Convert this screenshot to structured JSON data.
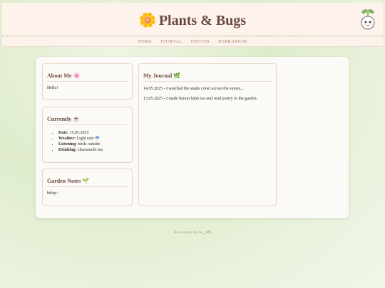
{
  "site": {
    "title": "Plants & Bugs",
    "title_icon": "sunflower-icon"
  },
  "nav": {
    "items": [
      "HOME",
      "JOURNAL",
      "PHOTOS",
      "HERBARIUM"
    ]
  },
  "about": {
    "heading": "About Me 🌸",
    "text": "Hello!"
  },
  "currently": {
    "heading": "Currently ☕",
    "items": [
      {
        "label": "Date:",
        "value": "15.05.2025"
      },
      {
        "label": "Weather:",
        "value": "Light rain ☔"
      },
      {
        "label": "Listening:",
        "value": "birds outside"
      },
      {
        "label": "Drinking:",
        "value": "chamomile tea"
      }
    ]
  },
  "garden": {
    "heading": "Garden Notes 🌱",
    "text": "hihip>"
  },
  "journal": {
    "heading": "My Journal 🌿",
    "entries": [
      "14.05.2025 - I watched the snails crawl across the stones...",
      "13.05.2025 - I made lemon balm tea and read poetry in the garden."
    ]
  },
  "footer": {
    "text": "Have a great day (◕‿◕✿)"
  },
  "colors": {
    "header_bg": "#fdf3ec",
    "title": "#6a4a3f",
    "accent": "#e7a21a",
    "page_bg": "#dfeccc"
  }
}
